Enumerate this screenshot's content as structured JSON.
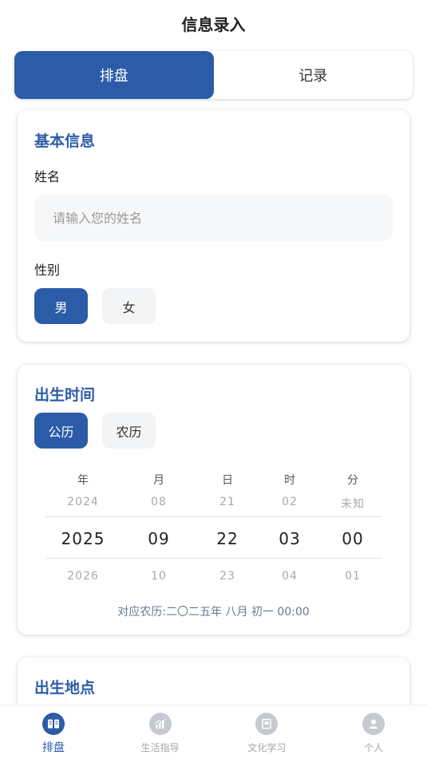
{
  "header": {
    "title": "信息录入"
  },
  "segment": {
    "tabs": [
      {
        "label": "排盘",
        "active": true
      },
      {
        "label": "记录",
        "active": false
      }
    ]
  },
  "basic": {
    "title": "基本信息",
    "name_label": "姓名",
    "name_placeholder": "请输入您的姓名",
    "name_value": "",
    "gender_label": "性别",
    "gender_options": [
      "男",
      "女"
    ],
    "gender_selected": "男"
  },
  "birth_time": {
    "title": "出生时间",
    "calendar_options": [
      "公历",
      "农历"
    ],
    "calendar_selected": "公历",
    "columns": [
      {
        "head": "年",
        "prev": "2024",
        "cur": "2025",
        "next": "2026"
      },
      {
        "head": "月",
        "prev": "08",
        "cur": "09",
        "next": "10"
      },
      {
        "head": "日",
        "prev": "21",
        "cur": "22",
        "next": "23"
      },
      {
        "head": "时",
        "prev": "02",
        "cur": "03",
        "next": "04"
      },
      {
        "head": "分",
        "prev": "未知",
        "cur": "00",
        "next": "01"
      }
    ],
    "lunar_note": "对应农历:二〇二五年 八月 初一 00:00"
  },
  "birth_place": {
    "title": "出生地点"
  },
  "tabbar": {
    "items": [
      {
        "label": "排盘",
        "icon": "book-icon",
        "active": true
      },
      {
        "label": "生活指导",
        "icon": "chart-icon",
        "active": false
      },
      {
        "label": "文化学习",
        "icon": "scroll-icon",
        "active": false
      },
      {
        "label": "个人",
        "icon": "user-icon",
        "active": false
      }
    ]
  },
  "colors": {
    "primary": "#2c5ca8",
    "muted": "#a9a9a9",
    "input_bg": "#f6f7f9"
  }
}
